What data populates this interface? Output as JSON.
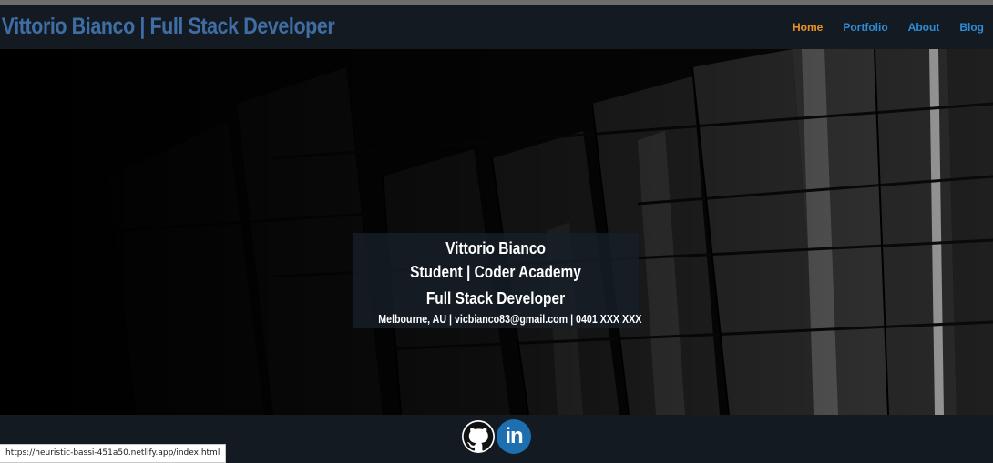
{
  "header": {
    "title": "Vittorio Bianco | Full Stack Developer",
    "nav": [
      {
        "label": "Home",
        "active": true
      },
      {
        "label": "Portfolio",
        "active": false
      },
      {
        "label": "About",
        "active": false
      },
      {
        "label": "Blog",
        "active": false
      }
    ]
  },
  "hero": {
    "name": "Vittorio Bianco",
    "role": "Student | Coder Academy",
    "title": "Full Stack Developer",
    "contact": "Melbourne, AU | vicbianco83@gmail.com | 0401 XXX XXX"
  },
  "footer": {
    "social": [
      {
        "icon": "github-icon"
      },
      {
        "icon": "linkedin-icon",
        "text": "in"
      }
    ]
  },
  "status_bar": {
    "url": "https://heuristic-bassi-451a50.netlify.app/index.html"
  },
  "colors": {
    "title": "#3f6ea5",
    "nav_link": "#2e8bd4",
    "nav_active": "#e9922a",
    "bar_bg": "#131a22",
    "linkedin": "#1e6fb0"
  }
}
